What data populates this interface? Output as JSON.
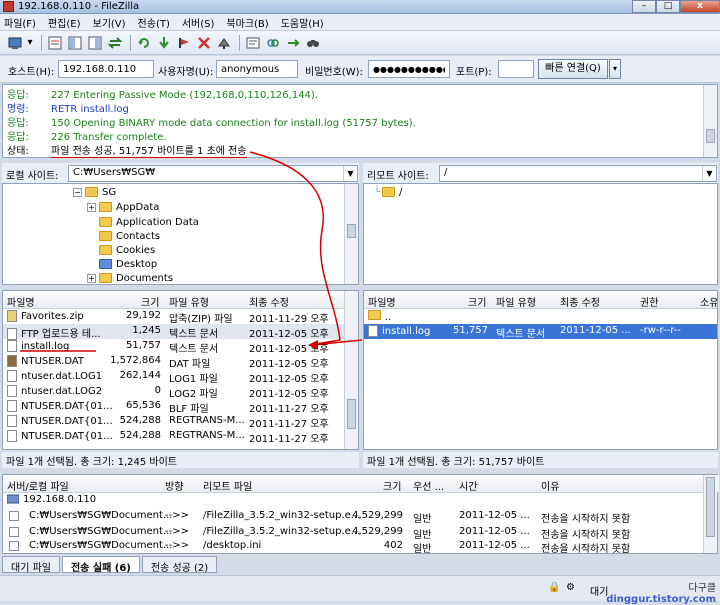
{
  "window": {
    "title": "192.168.0.110 - FileZilla",
    "minimize": "–",
    "maximize": "□",
    "close": "x"
  },
  "menu": [
    "파일(F)",
    "편집(E)",
    "보기(V)",
    "전송(T)",
    "서버(S)",
    "북마크(B)",
    "도움말(H)"
  ],
  "quickconnect": {
    "host_label": "호스트(H):",
    "host_value": "192.168.0.110",
    "user_label": "사용자명(U):",
    "user_value": "anonymous",
    "pass_label": "비밀번호(W):",
    "pass_value": "●●●●●●●●●●●●●",
    "port_label": "포트(P):",
    "port_value": "",
    "connect_label": "빠른 연결(Q)"
  },
  "log": [
    {
      "label": "응답:",
      "text": "227 Entering Passive Mode (192,168,0,110,126,144).",
      "color": "#1a7f1a"
    },
    {
      "label": "명령:",
      "text": "RETR install.log",
      "color": "#1f3fbf"
    },
    {
      "label": "응답:",
      "text": "150 Opening BINARY mode data connection for install.log (51757 bytes).",
      "color": "#1a7f1a"
    },
    {
      "label": "응답:",
      "text": "226 Transfer complete.",
      "color": "#1a7f1a"
    },
    {
      "label": "상태:",
      "text": "파일 전송 성공, 51,757 바이트를 1 초에 전송",
      "color": "#000000"
    }
  ],
  "local_site": {
    "label": "로컬 사이트:",
    "path": "C:₩Users₩SG₩"
  },
  "remote_site": {
    "label": "리모트 사이트:",
    "path": "/"
  },
  "local_tree": [
    "SG",
    "AppData",
    "Application Data",
    "Contacts",
    "Cookies",
    "Desktop",
    "Documents"
  ],
  "remote_tree": [
    "/"
  ],
  "local_columns": [
    "파일명",
    "크기",
    "파일 유형",
    "최종 수정"
  ],
  "local_files": [
    {
      "name": "Favorites.zip",
      "size": "29,192",
      "type": "압축(ZIP) 파일",
      "modified": "2011-11-29 오후",
      "icon": "zip"
    },
    {
      "name": "FTP 업로드용 테...",
      "size": "1,245",
      "type": "텍스트 문서",
      "modified": "2011-12-05 오후",
      "icon": "txt"
    },
    {
      "name": "install.log",
      "size": "51,757",
      "type": "텍스트 문서",
      "modified": "2011-12-05 오후",
      "icon": "txt"
    },
    {
      "name": "NTUSER.DAT",
      "size": "1,572,864",
      "type": "DAT 파일",
      "modified": "2011-12-05 오후",
      "icon": "dat"
    },
    {
      "name": "ntuser.dat.LOG1",
      "size": "262,144",
      "type": "LOG1 파일",
      "modified": "2011-12-05 오후",
      "icon": "txt"
    },
    {
      "name": "ntuser.dat.LOG2",
      "size": "0",
      "type": "LOG2 파일",
      "modified": "2011-12-05 오후",
      "icon": "txt"
    },
    {
      "name": "NTUSER.DAT{01...",
      "size": "65,536",
      "type": "BLF 파일",
      "modified": "2011-11-27 오후",
      "icon": "txt"
    },
    {
      "name": "NTUSER.DAT{01...",
      "size": "524,288",
      "type": "REGTRANS-M...",
      "modified": "2011-11-27 오후",
      "icon": "txt"
    },
    {
      "name": "NTUSER.DAT{01...",
      "size": "524,288",
      "type": "REGTRANS-M...",
      "modified": "2011-11-27 오후",
      "icon": "txt"
    }
  ],
  "remote_columns": [
    "파일명",
    "크기",
    "파일 유형",
    "최종 수정",
    "권한",
    "소유"
  ],
  "remote_files": [
    {
      "name": "..",
      "size": "",
      "type": "",
      "modified": "",
      "perm": ""
    },
    {
      "name": "install.log",
      "size": "51,757",
      "type": "텍스트 문서",
      "modified": "2011-12-05 ...",
      "perm": "-rw-r--r--"
    }
  ],
  "local_status": "파일 1개 선택됨. 총 크기: 1,245 바이트",
  "remote_status": "파일 1개 선택됨. 총 크기: 51,757 바이트",
  "queue_columns": [
    "서버/로컬 파일",
    "방향",
    "리모트 파일",
    "크기",
    "우선 ...",
    "시간",
    "이유"
  ],
  "queue_server": "192.168.0.110",
  "queue_rows": [
    {
      "local": "C:₩Users₩SG₩Document...",
      "dir": "-->>",
      "remote": "/FileZilla_3.5.2_win32-setup.e...",
      "size": "4,529,299",
      "priority": "일반",
      "time": "2011-12-05 ...",
      "reason": "전송을 시작하지 못함"
    },
    {
      "local": "C:₩Users₩SG₩Document...",
      "dir": "-->>",
      "remote": "/FileZilla_3.5.2_win32-setup.e...",
      "size": "4,529,299",
      "priority": "일반",
      "time": "2011-12-05 ...",
      "reason": "전송을 시작하지 못함"
    },
    {
      "local": "C:₩Users₩SG₩Document...",
      "dir": "-->>",
      "remote": "/desktop.ini",
      "size": "402",
      "priority": "일반",
      "time": "2011-12-05 ...",
      "reason": "전송을 시작하지 못함"
    }
  ],
  "tabs": [
    "대기 파일",
    "전송 실패 (6)",
    "전송 성공 (2)"
  ],
  "bottom_status": {
    "queue_label": "대기",
    "watermark": "다구클",
    "watermark_site": "dinggur.tistory.com"
  },
  "colors": {
    "annotation": "#d40000",
    "selection": "#3875d7",
    "tree_folder": "#f2c94c"
  }
}
